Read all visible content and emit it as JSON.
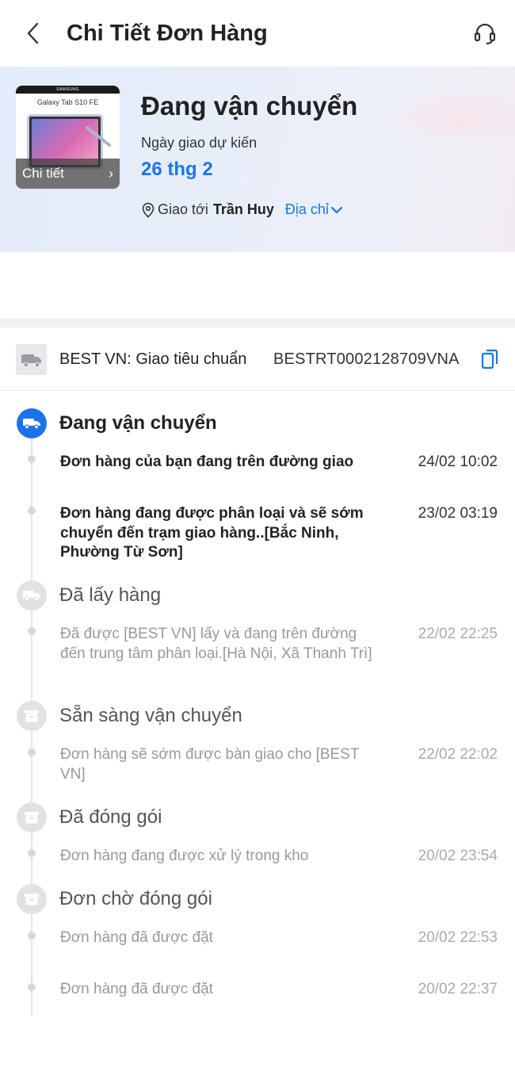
{
  "header": {
    "title": "Chi Tiết Đơn Hàng",
    "back_icon": "chevron-left-icon",
    "support_icon": "headset-icon"
  },
  "hero": {
    "product_image_brand": "SAMSUNG",
    "product_image_model": "Galaxy Tab S10 FE",
    "details_label": "Chi tiết",
    "status": "Đang vận chuyển",
    "eta_label": "Ngày giao dự kiến",
    "eta_date": "26 thg 2",
    "deliver_to_label": "Giao tới",
    "recipient": "Trần Huy",
    "address_link": "Địa chỉ"
  },
  "carrier": {
    "name": "BEST VN: Giao tiêu chuẩn",
    "tracking_number": "BESTRT0002128709VNA",
    "copy_icon": "copy-icon"
  },
  "timeline": {
    "stages": [
      {
        "title": "Đang vận chuyển",
        "icon": "truck-icon",
        "state": "active",
        "events": [
          {
            "text": "Đơn hàng của bạn đang trên đường giao",
            "time": "24/02 10:02"
          },
          {
            "text": "Đơn hàng đang được phân loại và sẽ sớm chuyển đến trạm giao hàng..[Bắc Ninh, Phường Từ Sơn]",
            "time": "23/02 03:19"
          }
        ]
      },
      {
        "title": "Đã lấy hàng",
        "icon": "truck-icon",
        "state": "done",
        "events": [
          {
            "text": "Đã được [BEST VN] lấy và đang trên đường đến trung tâm phân loại.[Hà Nội, Xã Thanh Trì]",
            "time": "22/02 22:25"
          }
        ]
      },
      {
        "title": "Sẵn sàng vận chuyển",
        "icon": "box-icon",
        "state": "done",
        "events": [
          {
            "text": "Đơn hàng sẽ sớm được bàn giao cho [BEST VN]",
            "time": "22/02 22:02"
          }
        ]
      },
      {
        "title": "Đã đóng gói",
        "icon": "box-icon",
        "state": "done",
        "events": [
          {
            "text": "Đơn hàng đang được xử lý trong kho",
            "time": "20/02 23:54"
          }
        ]
      },
      {
        "title": "Đơn chờ đóng gói",
        "icon": "box-icon",
        "state": "done",
        "events": [
          {
            "text": "Đơn hàng đã được đặt",
            "time": "20/02 22:53"
          },
          {
            "text": "Đơn hàng đã được đặt",
            "time": "20/02 22:37"
          }
        ]
      }
    ]
  }
}
